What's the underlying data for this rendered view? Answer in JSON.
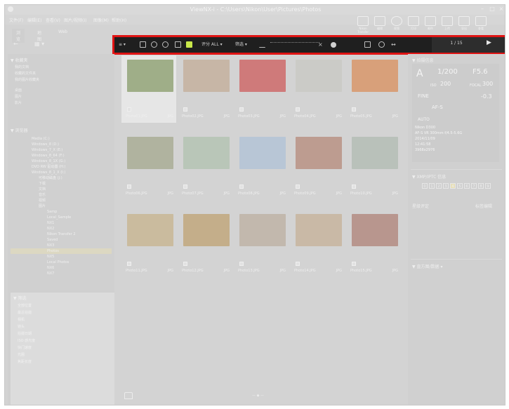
{
  "window": {
    "title": "ViewNX-i - C:\\Users\\Nikon\\User\\Pictures\\Photos",
    "minimize": "–",
    "maximize": "□",
    "close": "×"
  },
  "menu": [
    "文件(F)",
    "编辑(E)",
    "查看(V)",
    "图片/视频(I)",
    "图像(M)",
    "帮助(H)"
  ],
  "top_right_icons": [
    {
      "icon": "camera-transfer-icon",
      "label": "Nikon Transfer"
    },
    {
      "icon": "edit-icon",
      "label": "编辑"
    },
    {
      "icon": "movie-icon",
      "label": "视频"
    },
    {
      "icon": "print-icon",
      "label": "打印"
    },
    {
      "icon": "mail-icon",
      "label": "邮件"
    },
    {
      "icon": "upload-icon",
      "label": "上传"
    },
    {
      "icon": "export-icon",
      "label": "导出"
    },
    {
      "icon": "viewer-icon",
      "label": "查看"
    }
  ],
  "mode_tabs": [
    "浏览",
    "地图",
    "Web"
  ],
  "toolbar": {
    "menu_label": "≡ ▾",
    "rating_label": "评分 ALL ▾",
    "filter_label": "筛选 ▾",
    "counter": "1 / 15",
    "play": "▶"
  },
  "left_panel": {
    "nav_back": "←",
    "nav_view": "▦ ▾",
    "favorites_header": "▼ 收藏夹",
    "favorites": [
      "我的文档",
      "收藏的文件夹",
      "我的图片收藏夹"
    ],
    "computer_items": [
      "桌面",
      "图片",
      "影片"
    ],
    "browse_header": "▼ 浏览器",
    "tree": [
      {
        "label": "Media (C:)",
        "selected": false
      },
      {
        "label": "Windows_8 (D:)",
        "selected": false
      },
      {
        "label": "Windows_7_X (E:)",
        "selected": false
      },
      {
        "label": "Windows_8_64 (F:)",
        "selected": false
      },
      {
        "label": "Windows_8_1X (G:)",
        "selected": false
      },
      {
        "label": "DVD RW 驱动器 (H:)",
        "selected": false
      },
      {
        "label": "Windows_8_1_X (I:)",
        "selected": false
      },
      {
        "label": "可移动磁盘 (J:)",
        "selected": false
      },
      {
        "label": "下载",
        "selected": false
      },
      {
        "label": "文档",
        "selected": false
      },
      {
        "label": "音乐",
        "selected": false
      },
      {
        "label": "视频",
        "selected": false
      },
      {
        "label": "图片",
        "selected": false
      },
      {
        "label": "Samp",
        "selected": false
      },
      {
        "label": "Local_Sample",
        "selected": false
      },
      {
        "label": "NX1",
        "selected": false
      },
      {
        "label": "NX2",
        "selected": false
      },
      {
        "label": "Nikon Transfer 2",
        "selected": false
      },
      {
        "label": "Saved",
        "selected": false
      },
      {
        "label": "NX3",
        "selected": false
      },
      {
        "label": "Photos",
        "selected": true
      },
      {
        "label": "NX5",
        "selected": false
      },
      {
        "label": "Local Photos",
        "selected": false
      },
      {
        "label": "NX6",
        "selected": false
      },
      {
        "label": "NX7",
        "selected": false
      }
    ],
    "lower_header": "▼ 筛选",
    "lower_items": [
      "全部位置",
      "最近拍摄",
      "相机",
      "镜头",
      "拍摄日期",
      "ISO 感光度",
      "快门速度",
      "光圈",
      "焦距长度"
    ]
  },
  "thumbnails": [
    {
      "name": "Photo01.JPG",
      "format": "JPG",
      "color": "#9fae88",
      "selected": true
    },
    {
      "name": "Photo02.JPG",
      "format": "JPG",
      "color": "#c7b6a6",
      "selected": false
    },
    {
      "name": "Photo03.JPG",
      "format": "JPG",
      "color": "#cf7a7a",
      "selected": false
    },
    {
      "name": "Photo04.JPG",
      "format": "JPG",
      "color": "#cbcbc7",
      "selected": false
    },
    {
      "name": "Photo05.JPG",
      "format": "JPG",
      "color": "#d8a07a",
      "selected": false
    },
    {
      "name": "Photo06.JPG",
      "format": "JPG",
      "color": "#b0b39f",
      "selected": false
    },
    {
      "name": "Photo07.JPG",
      "format": "JPG",
      "color": "#b9c6b8",
      "selected": false
    },
    {
      "name": "Photo08.JPG",
      "format": "JPG",
      "color": "#b8c6d6",
      "selected": false
    },
    {
      "name": "Photo09.JPG",
      "format": "JPG",
      "color": "#bd9c90",
      "selected": false
    },
    {
      "name": "Photo10.JPG",
      "format": "JPG",
      "color": "#b9c1ba",
      "selected": false
    },
    {
      "name": "Photo11.JPG",
      "format": "JPG",
      "color": "#cabb9e",
      "selected": false
    },
    {
      "name": "Photo12.JPG",
      "format": "JPG",
      "color": "#c4ae8a",
      "selected": false
    },
    {
      "name": "Photo13.JPG",
      "format": "JPG",
      "color": "#c2b8ad",
      "selected": false
    },
    {
      "name": "Photo14.JPG",
      "format": "JPG",
      "color": "#c9b9a6",
      "selected": false
    },
    {
      "name": "Photo15.JPG",
      "format": "JPG",
      "color": "#b8968e",
      "selected": false
    }
  ],
  "grid_footer": {
    "center": "— ◆ —"
  },
  "right_panel": {
    "info_header": "▼ 拍摄信息",
    "mode": "A",
    "shutter": "1/200",
    "aperture": "F5.6",
    "iso_label": "ISO",
    "iso": "200",
    "focal_label": "FOCAL",
    "focal": "300",
    "quality": "FINE",
    "ev": "-0.3",
    "af": "AF-S",
    "wb": "AUTO",
    "meta_lines": [
      "Nikon D300",
      "AF-S VR 300mm f/4.5-5.6G",
      "2014/11/09",
      "12:41:58",
      "3968x2976"
    ],
    "rating_header": "▼ XMP/IPTC 信息",
    "rating_cells": [
      "0",
      "1",
      "2",
      "3",
      "4",
      "5",
      "6",
      "7",
      "8",
      "9"
    ],
    "marked_cell": 4,
    "label_title": "星级评定",
    "label_action": "标签编辑",
    "histogram_header": "▼ 直方图/数据 ▾"
  }
}
